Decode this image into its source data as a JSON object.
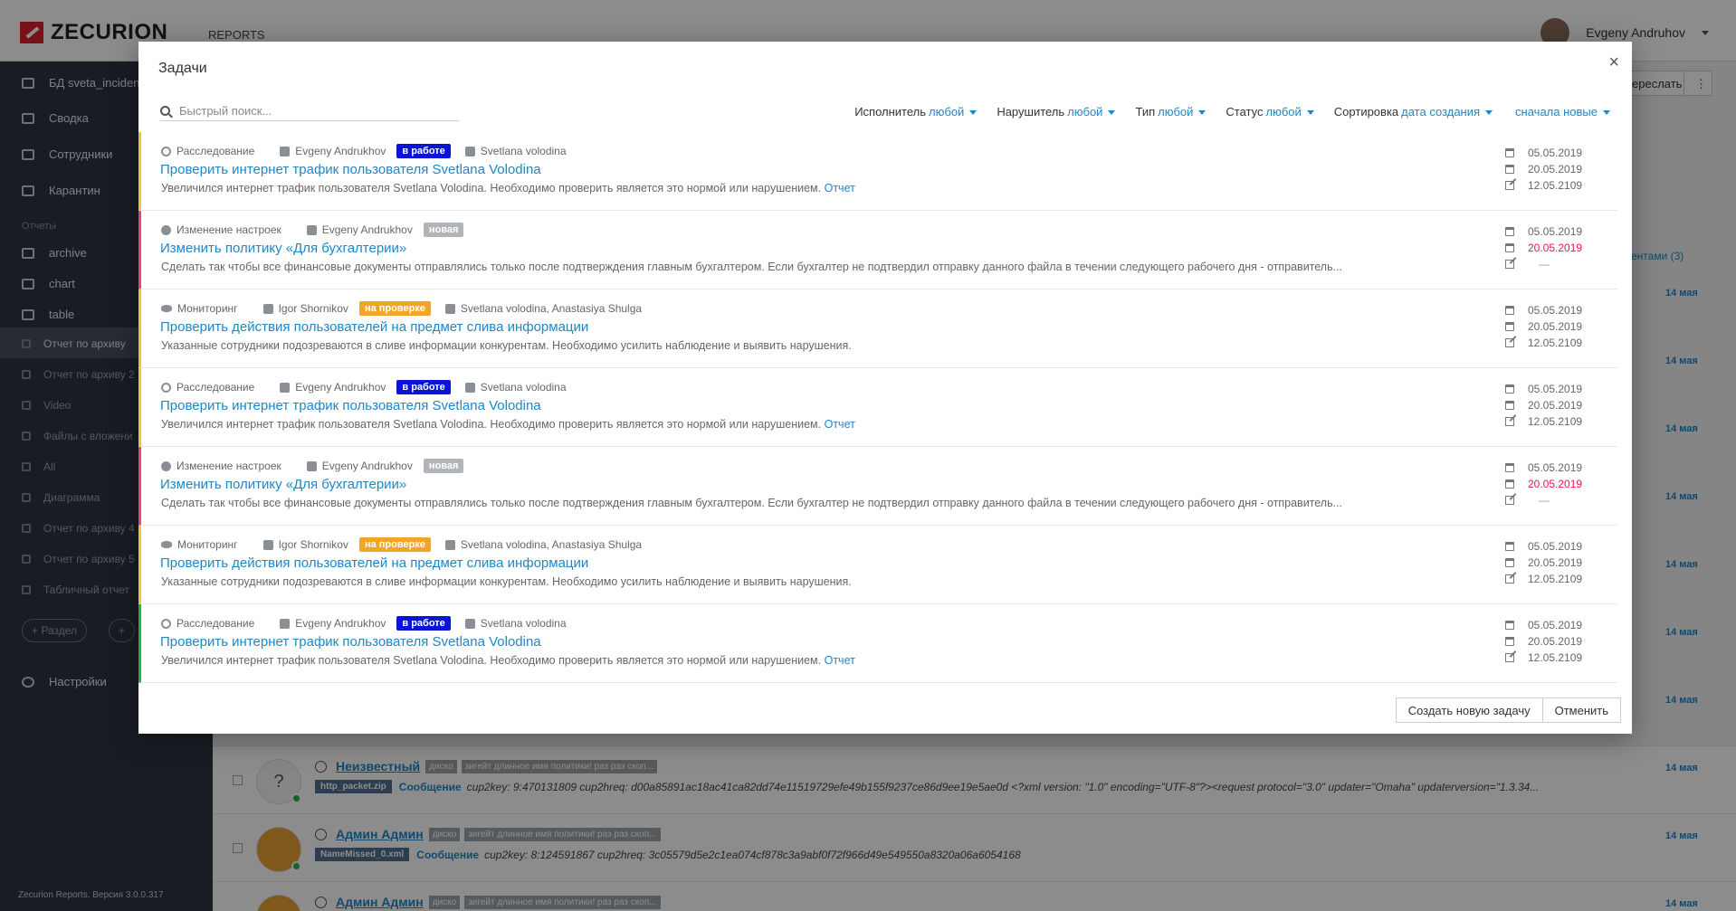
{
  "app": {
    "logo_text": "ZECURION",
    "nav_reports": "REPORTS",
    "user_name": "Evgeny Andruhov",
    "version": "Zecurion Reports. Версия 3.0.0.317"
  },
  "sidebar": {
    "items": [
      {
        "label": "БД sveta_inciden"
      },
      {
        "label": "Сводка"
      },
      {
        "label": "Сотрудники"
      },
      {
        "label": "Карантин"
      }
    ],
    "group_label": "Отчеты",
    "reports": [
      {
        "label": "archive"
      },
      {
        "label": "chart"
      },
      {
        "label": "table"
      },
      {
        "label": "Отчет по архиву"
      },
      {
        "label": "Отчет по архиву 2"
      },
      {
        "label": "Video"
      },
      {
        "label": "Файлы с вложени"
      },
      {
        "label": "All"
      },
      {
        "label": "Диаграмма"
      },
      {
        "label": "Отчет по архиву 4"
      },
      {
        "label": "Отчет по архиву 5"
      },
      {
        "label": "Табличный отчет"
      }
    ],
    "add_section": "+ Раздел",
    "add_more": "+",
    "settings": "Настройки"
  },
  "background": {
    "resend_btn": "ереслать",
    "more_btn": "⋮",
    "incidents_link": "дентами (3)",
    "date_label": "14 мая",
    "feed": [
      {
        "name": "Неизвестный",
        "tag1": "диско",
        "tag2": "зигейт длинное имя политики! раз раз скоп...",
        "file": "http_packet.zip",
        "msg_label": "Сообщение",
        "msg": "cup2key: 9:470131809 cup2hreq: d00a85891ac18ac41ca82dd74e11519729efe49b155f9237ce86d9ee19e5ae0d <?xml version: \"1.0\" encoding=\"UTF-8\"?><request protocol=\"3.0\" updater=\"Omaha\" updaterversion=\"1.3.34...",
        "date": "14 мая"
      },
      {
        "name": "Админ Админ",
        "tag1": "диско",
        "tag2": "зигейт длинное имя политики! раз раз скоп...",
        "file": "NameMissed_0.xml",
        "msg_label": "Сообщение",
        "msg": "cup2key: 8:124591867 cup2hreq: 3c05579d5e2c1ea074cf878c3a9abf0f72f966d49e549550a8320a06a6054168",
        "date": "14 мая"
      },
      {
        "name": "Админ Админ",
        "tag1": "диско",
        "tag2": "зигейт длинное имя политики! раз раз скоп...",
        "date": "14 мая"
      }
    ]
  },
  "modal": {
    "title": "Задачи",
    "close": "×",
    "search_placeholder": "Быстрый поиск...",
    "filters": [
      {
        "label": "Исполнитель",
        "value": "любой"
      },
      {
        "label": "Нарушитель",
        "value": "любой"
      },
      {
        "label": "Тип",
        "value": "любой"
      },
      {
        "label": "Статус",
        "value": "любой"
      },
      {
        "label": "Сортировка",
        "value": "дата создания"
      },
      {
        "label": "",
        "value": "сначала новые"
      }
    ],
    "tasks": [
      {
        "type": "Расследование",
        "assignee": "Evgeny Andrukhov",
        "status": "в работе",
        "status_color": "#0a14d8",
        "violator": "Svetlana volodina",
        "title": "Проверить интернет трафик пользователя Svetlana Volodina",
        "desc": "Увеличился интернет трафик пользователя Svetlana Volodina. Необходимо проверить является это нормой или нарушением.",
        "report": "Отчет",
        "created": "05.05.2019",
        "deadline": "20.05.2019",
        "edited": "12.05.2109",
        "accent": "#f2c037"
      },
      {
        "type": "Изменение настроек",
        "assignee": "Evgeny Andrukhov",
        "status": "новая",
        "status_color": "#b1b4b8",
        "violator": "",
        "title": "Изменить политику «Для бухгалтерии»",
        "desc": "Сделать так чтобы все финансовые документы отправлялись только после подтверждения главным бухгалтером. Если бухгалтер не подтвердил отправку данного файла в течении следующего рабочего дня - отправитель...",
        "report": "",
        "created": "05.05.2019",
        "deadline": "20.05.2019",
        "edited": "—",
        "accent": "#e8447a"
      },
      {
        "type": "Мониторинг",
        "assignee": "Igor Shornikov",
        "status": "на проверке",
        "status_color": "#f5a524",
        "violator": "Svetlana volodina, Anastasiya Shulga",
        "title": "Проверить действия пользователей на предмет слива информации",
        "desc": "Указанные сотрудники подозреваются в сливе информации конкурентам. Необходимо усилить наблюдение и выявить  нарушения.",
        "report": "",
        "created": "05.05.2019",
        "deadline": "20.05.2019",
        "edited": "12.05.2109",
        "accent": "#f2c037"
      },
      {
        "type": "Расследование",
        "assignee": "Evgeny Andrukhov",
        "status": "в работе",
        "status_color": "#0a14d8",
        "violator": "Svetlana volodina",
        "title": "Проверить интернет трафик пользователя Svetlana Volodina",
        "desc": "Увеличился интернет трафик пользователя Svetlana Volodina. Необходимо проверить является это нормой или нарушением.",
        "report": "Отчет",
        "created": "05.05.2019",
        "deadline": "20.05.2019",
        "edited": "12.05.2109",
        "accent": "#f2c037"
      },
      {
        "type": "Изменение настроек",
        "assignee": "Evgeny Andrukhov",
        "status": "новая",
        "status_color": "#b1b4b8",
        "violator": "",
        "title": "Изменить политику «Для бухгалтерии»",
        "desc": "Сделать так чтобы все финансовые документы отправлялись только после подтверждения главным бухгалтером. Если бухгалтер не подтвердил отправку данного файла в течении следующего рабочего дня - отправитель...",
        "report": "",
        "created": "05.05.2019",
        "deadline": "20.05.2019",
        "edited": "—",
        "accent": "#e8447a"
      },
      {
        "type": "Мониторинг",
        "assignee": "Igor Shornikov",
        "status": "на проверке",
        "status_color": "#f5a524",
        "violator": "Svetlana volodina, Anastasiya Shulga",
        "title": "Проверить действия пользователей на предмет слива информации",
        "desc": "Указанные сотрудники подозреваются в сливе информации конкурентам. Необходимо усилить наблюдение и выявить  нарушения.",
        "report": "",
        "created": "05.05.2019",
        "deadline": "20.05.2019",
        "edited": "12.05.2109",
        "accent": "#f2c037"
      },
      {
        "type": "Расследование",
        "assignee": "Evgeny Andrukhov",
        "status": "в работе",
        "status_color": "#0a14d8",
        "violator": "Svetlana volodina",
        "title": "Проверить интернет трафик пользователя Svetlana Volodina",
        "desc": "Увеличился интернет трафик пользователя Svetlana Volodina. Необходимо проверить является это нормой или нарушением.",
        "report": "Отчет",
        "created": "05.05.2019",
        "deadline": "20.05.2019",
        "edited": "12.05.2109",
        "accent": "#26b24b"
      }
    ],
    "create_button": "Создать новую задачу",
    "cancel_button": "Отменить"
  }
}
